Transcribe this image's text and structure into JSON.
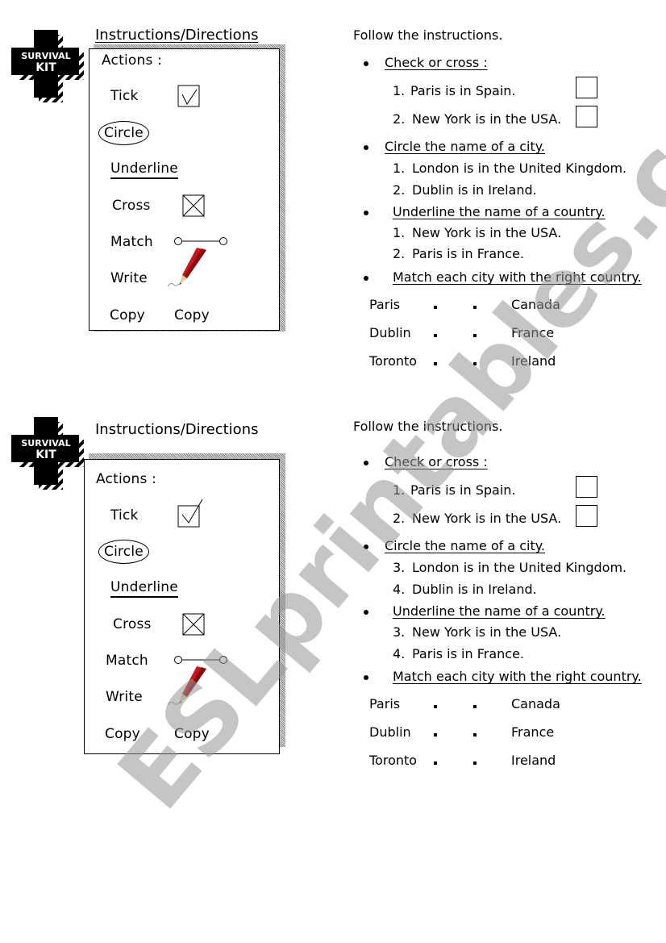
{
  "worksheets": [
    {
      "logo": {
        "line1": "SURVIVAL",
        "line2": "KIT"
      },
      "panel_title": "Instructions/Directions",
      "actions_label": "Actions :",
      "actions": {
        "tick": "Tick",
        "circle": "Circle",
        "underline": "Underline",
        "cross": "Cross",
        "match": "Match",
        "write": "Write",
        "copy1": "Copy",
        "copy2": "Copy"
      },
      "follow": "Follow the instructions.",
      "sections": [
        {
          "heading": "Check or cross :",
          "items": [
            {
              "num": "1.",
              "text": "Paris is in Spain."
            },
            {
              "num": "2.",
              "text": "New York is in the USA."
            }
          ]
        },
        {
          "heading": "Circle the name of a city.",
          "items": [
            {
              "num": "1.",
              "text": "London is in the United Kingdom."
            },
            {
              "num": "2.",
              "text": "Dublin is in Ireland."
            }
          ]
        },
        {
          "heading": "Underline the name of a country.",
          "items": [
            {
              "num": "1.",
              "text": "New York is in the USA."
            },
            {
              "num": "2.",
              "text": "Paris is in France."
            }
          ]
        },
        {
          "heading": "Match each city with the right country.",
          "items": []
        }
      ],
      "match": {
        "cities": [
          "Paris",
          "Dublin",
          "Toronto"
        ],
        "countries": [
          "Canada",
          "France",
          "Ireland"
        ]
      }
    },
    {
      "logo": {
        "line1": "SURVIVAL",
        "line2": "KIT"
      },
      "panel_title": "Instructions/Directions",
      "actions_label": "Actions :",
      "actions": {
        "tick": "Tick",
        "circle": "Circle",
        "underline": "Underline",
        "cross": "Cross",
        "match": "Match",
        "write": "Write",
        "copy1": "Copy",
        "copy2": "Copy"
      },
      "follow": "Follow the instructions.",
      "sections": [
        {
          "heading": "Check or cross :",
          "items": [
            {
              "num": "1.",
              "text": "Paris is in Spain."
            },
            {
              "num": "2.",
              "text": "New York is in the USA."
            }
          ]
        },
        {
          "heading": "Circle the name of a city.",
          "items": [
            {
              "num": "3.",
              "text": "London is in the United Kingdom."
            },
            {
              "num": "4.",
              "text": "Dublin is in Ireland."
            }
          ]
        },
        {
          "heading": "Underline the name of a country.",
          "items": [
            {
              "num": "3.",
              "text": "New York is in the USA."
            },
            {
              "num": "4.",
              "text": "Paris is in France."
            }
          ]
        },
        {
          "heading": "Match each city with the right country.",
          "items": []
        }
      ],
      "match": {
        "cities": [
          "Paris",
          "Dublin",
          "Toronto"
        ],
        "countries": [
          "Canada",
          "France",
          "Ireland"
        ]
      }
    }
  ],
  "watermark": "ESLprintables.com"
}
